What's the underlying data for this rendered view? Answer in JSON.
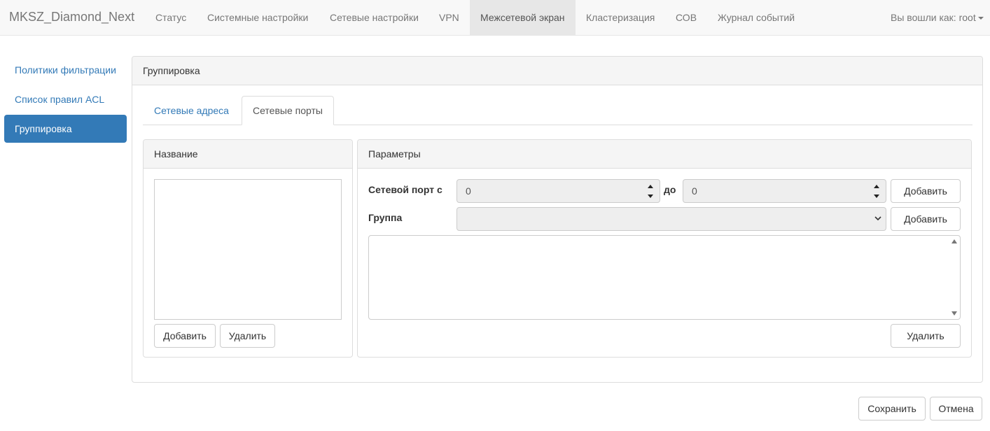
{
  "navbar": {
    "brand": "MKSZ_Diamond_Next",
    "items": [
      {
        "label": "Статус"
      },
      {
        "label": "Системные настройки"
      },
      {
        "label": "Сетевые настройки"
      },
      {
        "label": "VPN"
      },
      {
        "label": "Межсетевой экран"
      },
      {
        "label": "Кластеризация"
      },
      {
        "label": "СОВ"
      },
      {
        "label": "Журнал событий"
      }
    ],
    "active_item": "Межсетевой экран",
    "user_label": "Вы вошли как: root"
  },
  "sidebar": {
    "items": [
      {
        "label": "Политики фильтрации"
      },
      {
        "label": "Список правил ACL"
      },
      {
        "label": "Группировка"
      }
    ],
    "active_item": "Группировка"
  },
  "main": {
    "title": "Группировка",
    "tabs": [
      {
        "label": "Сетевые адреса"
      },
      {
        "label": "Сетевые порты"
      }
    ],
    "active_tab": "Сетевые порты",
    "names_panel": {
      "title": "Название",
      "add_label": "Добавить",
      "delete_label": "Удалить"
    },
    "params_panel": {
      "title": "Параметры",
      "port_from_label": "Сетевой порт с",
      "port_from_value": "0",
      "port_to_label": "до",
      "port_to_value": "0",
      "add_port_label": "Добавить",
      "group_label": "Группа",
      "group_value": "",
      "add_group_label": "Добавить",
      "delete_label": "Удалить"
    }
  },
  "footer": {
    "save_label": "Сохранить",
    "cancel_label": "Отмена"
  },
  "colors": {
    "accent": "#337ab7",
    "navbar_bg": "#f8f8f8",
    "navbar_active_bg": "#e7e7e7",
    "panel_heading_bg": "#f5f5f5",
    "disabled_input_bg": "#eeeeee"
  }
}
